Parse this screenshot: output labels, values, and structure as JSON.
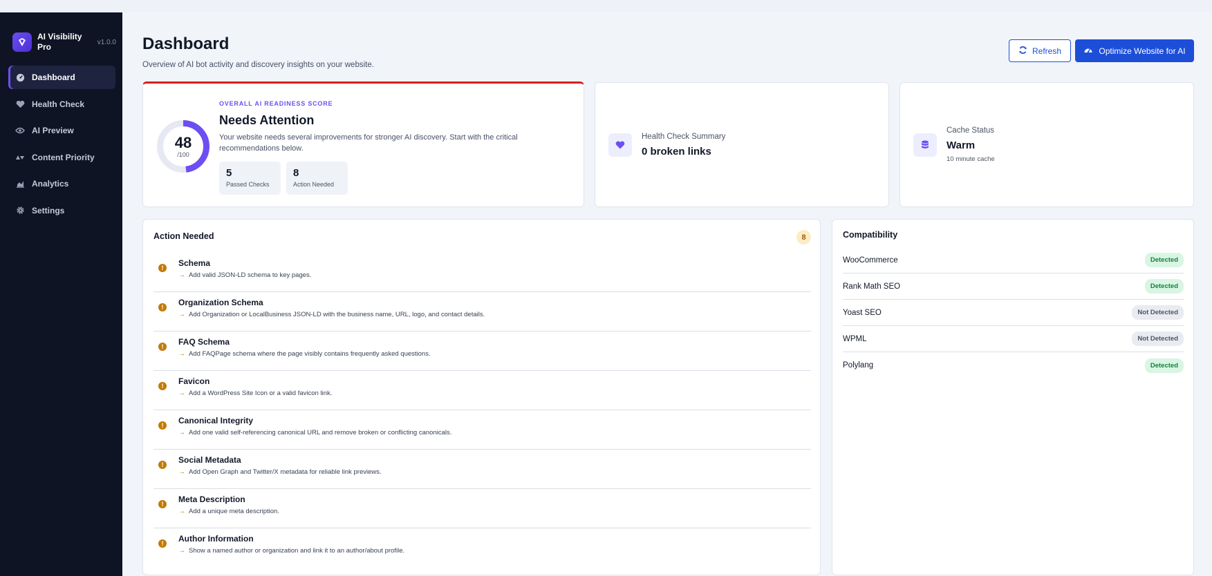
{
  "app": {
    "name": "AI Visibility Pro",
    "version": "v1.0.0"
  },
  "sidebar": {
    "items": [
      {
        "label": "Dashboard",
        "icon": "gauge-icon",
        "active": true
      },
      {
        "label": "Health Check",
        "icon": "heart-icon"
      },
      {
        "label": "AI Preview",
        "icon": "eye-icon"
      },
      {
        "label": "Content Priority",
        "icon": "priority-icon"
      },
      {
        "label": "Analytics",
        "icon": "chart-icon"
      },
      {
        "label": "Settings",
        "icon": "gear-icon"
      }
    ]
  },
  "header": {
    "title": "Dashboard",
    "subtitle": "Overview of AI bot activity and discovery insights on your website.",
    "refresh_label": "Refresh",
    "optimize_label": "Optimize Website for AI"
  },
  "score": {
    "value": "48",
    "max": "/100",
    "fraction": 0.48,
    "kicker": "OVERALL AI READINESS SCORE",
    "status": "Needs Attention",
    "description": "Your website needs several improvements for stronger AI discovery. Start with the critical recommendations below.",
    "passed_count": "5",
    "passed_label": "Passed Checks",
    "action_count": "8",
    "action_label": "Action Needed"
  },
  "health": {
    "label": "Health Check Summary",
    "value": "0 broken links"
  },
  "cache": {
    "label": "Cache Status",
    "value": "Warm",
    "note": "10 minute cache"
  },
  "actions": {
    "title": "Action Needed",
    "count": "8",
    "items": [
      {
        "name": "Schema",
        "rec": "Add valid JSON-LD schema to key pages."
      },
      {
        "name": "Organization Schema",
        "rec": "Add Organization or LocalBusiness JSON-LD with the business name, URL, logo, and contact details."
      },
      {
        "name": "FAQ Schema",
        "rec": "Add FAQPage schema where the page visibly contains frequently asked questions."
      },
      {
        "name": "Favicon",
        "rec": "Add a WordPress Site Icon or a valid favicon link."
      },
      {
        "name": "Canonical Integrity",
        "rec": "Add one valid self-referencing canonical URL and remove broken or conflicting canonicals."
      },
      {
        "name": "Social Metadata",
        "rec": "Add Open Graph and Twitter/X metadata for reliable link previews."
      },
      {
        "name": "Meta Description",
        "rec": "Add a unique meta description."
      },
      {
        "name": "Author Information",
        "rec": "Show a named author or organization and link it to an author/about profile."
      }
    ]
  },
  "compat": {
    "title": "Compatibility",
    "items": [
      {
        "name": "WooCommerce",
        "status": "Detected"
      },
      {
        "name": "Rank Math SEO",
        "status": "Detected"
      },
      {
        "name": "Yoast SEO",
        "status": "Not Detected"
      },
      {
        "name": "WPML",
        "status": "Not Detected"
      },
      {
        "name": "Polylang",
        "status": "Detected"
      }
    ]
  },
  "colors": {
    "accent": "#6d4ef2",
    "primary": "#1d4ed8",
    "alert": "#d61f1f",
    "warning": "#c27a06"
  }
}
